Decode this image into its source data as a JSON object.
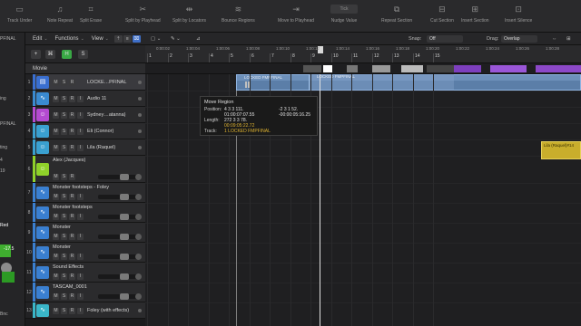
{
  "toolbar": {
    "items": [
      {
        "label": "Track Under",
        "icon": "track-icon"
      },
      {
        "label": "Note Repeat",
        "icon": "note-icon"
      },
      {
        "label": "Split Erase",
        "icon": "split-erase-icon"
      },
      {
        "label": "Split by Playhead",
        "icon": "scissors-icon"
      },
      {
        "label": "Split by Locators",
        "icon": "split-locators-icon"
      },
      {
        "label": "Bounce Regions",
        "icon": "bounce-icon"
      },
      {
        "label": "Move to Playhead",
        "icon": "move-icon"
      },
      {
        "label": "Nudge Value",
        "icon": "nudge-icon"
      },
      {
        "label": "Repeat Section",
        "icon": "repeat-icon"
      },
      {
        "label": "Cut Section",
        "icon": "cut-icon"
      },
      {
        "label": "Insert Section",
        "icon": "insert-icon"
      },
      {
        "label": "Insert Silence",
        "icon": "silence-icon"
      }
    ],
    "nudge_value": "Tick"
  },
  "inspector": {
    "texts": [
      "PFINAL",
      "ing",
      "PFINAL",
      "ting",
      "4",
      "19",
      "Red",
      "-17.5",
      "Bnc"
    ]
  },
  "tracks_header": {
    "edit": "Edit",
    "functions": "Functions",
    "view": "View"
  },
  "track_tools": [
    "+",
    "⌘",
    "H",
    "S"
  ],
  "movie_label": "Movie",
  "control_bar": {
    "snap_label": "Snap:",
    "snap_value": "Off",
    "drag_label": "Drag:",
    "drag_value": "Overlap"
  },
  "ruler": {
    "bars": [
      "1",
      "2",
      "3",
      "4",
      "5",
      "6",
      "7",
      "8",
      "9",
      "10",
      "11",
      "12",
      "13",
      "14",
      "15"
    ],
    "times": [
      "0:00:02",
      "1:00:04",
      "1:00:06",
      "1:00:08",
      "1:00:10",
      "1:00:12",
      "1:00:14",
      "1:00:16",
      "1:00:18",
      "1:00:20",
      "1:00:22",
      "1:00:24",
      "1:00:26",
      "1:00:28"
    ]
  },
  "tracks": [
    {
      "num": "1",
      "name": "LOCKE…PFINAL",
      "color": "#3a6fd0",
      "icon": "film-icon",
      "btns": [
        "M",
        "S",
        "R"
      ],
      "selected": true,
      "fader": false
    },
    {
      "num": "2",
      "name": "Audio 11",
      "color": "#3a8ad0",
      "icon": "waveform-icon",
      "btns": [
        "M",
        "S",
        "R",
        "I"
      ],
      "selected": false,
      "fader": false
    },
    {
      "num": "3",
      "name": "Sydney…atanna)",
      "color": "#b44ad0",
      "icon": "person-icon",
      "btns": [
        "M",
        "S",
        "R",
        "I"
      ],
      "selected": false,
      "fader": false
    },
    {
      "num": "4",
      "name": "Eli (Connor)",
      "color": "#3aa0d0",
      "icon": "person-icon",
      "btns": [
        "M",
        "S",
        "R",
        "I"
      ],
      "selected": false,
      "fader": false
    },
    {
      "num": "5",
      "name": "Lila (Raquel)",
      "color": "#3aa0d0",
      "icon": "person-icon",
      "btns": [
        "M",
        "S",
        "R",
        "I"
      ],
      "selected": false,
      "fader": false
    },
    {
      "num": "6",
      "name": "Alex (Jacques)",
      "color": "#8fd12a",
      "icon": "person-icon",
      "btns": [
        "M",
        "S",
        "R"
      ],
      "selected": false,
      "fader": true
    },
    {
      "num": "7",
      "name": "Monster footsteps - Foley",
      "color": "#3a7fd0",
      "icon": "waveform-icon",
      "btns": [
        "M",
        "S",
        "R",
        "I"
      ],
      "selected": false,
      "fader": true
    },
    {
      "num": "8",
      "name": "Monster footsteps",
      "color": "#3a7fd0",
      "icon": "waveform-icon",
      "btns": [
        "M",
        "S",
        "R",
        "I"
      ],
      "selected": false,
      "fader": true
    },
    {
      "num": "9",
      "name": "Monster",
      "color": "#3a7fd0",
      "icon": "waveform-icon",
      "btns": [
        "M",
        "S",
        "R",
        "I"
      ],
      "selected": false,
      "fader": true
    },
    {
      "num": "10",
      "name": "Monster",
      "color": "#3a7fd0",
      "icon": "waveform-icon",
      "btns": [
        "M",
        "S",
        "R",
        "I"
      ],
      "selected": false,
      "fader": true
    },
    {
      "num": "11",
      "name": "Sound Effects",
      "color": "#3a7fd0",
      "icon": "waveform-icon",
      "btns": [
        "M",
        "S",
        "R",
        "I"
      ],
      "selected": false,
      "fader": true
    },
    {
      "num": "12",
      "name": "TASCAM_0001",
      "color": "#3a7fd0",
      "icon": "waveform-icon",
      "btns": [
        "M",
        "S",
        "R",
        "I"
      ],
      "selected": false,
      "fader": true
    },
    {
      "num": "13",
      "name": "Foley (with effects)",
      "color": "#3ab6c8",
      "icon": "waveform-icon",
      "btns": [
        "M",
        "S",
        "R",
        "I"
      ],
      "selected": false,
      "fader": false
    }
  ],
  "regions": {
    "movie_region": "LOCKED FMPFINAL",
    "ghost_region": "LOCKED FMPFINAL",
    "yellow_region": "Lila (Raquel)#14"
  },
  "tooltip": {
    "title": "Move Region",
    "position_label": "Position:",
    "position_bars": "4 3 3 111.",
    "position_offset": "-2 3 1 52.",
    "position_time": "01:00:07:07.55",
    "position_time_offset": "-00:00:05:16.25",
    "length_label": "Length:",
    "length_bars": "272 3 3 78.",
    "length_time": "00:09:05:22.72",
    "track_label": "Track:",
    "track_value": "1  LOCKED FMPFINAL"
  }
}
